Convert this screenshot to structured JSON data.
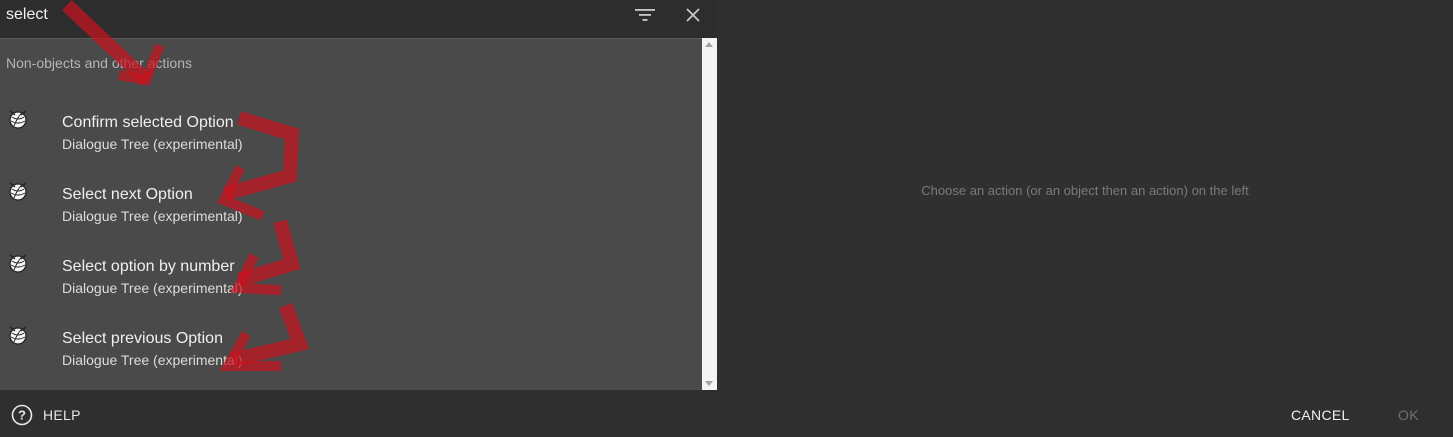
{
  "search": {
    "value": "select"
  },
  "list": {
    "section_label": "Non-objects and other actions",
    "items": [
      {
        "name": "Confirm selected Option",
        "group": "Dialogue Tree (experimental)"
      },
      {
        "name": "Select next Option",
        "group": "Dialogue Tree (experimental)"
      },
      {
        "name": "Select option by number",
        "group": "Dialogue Tree (experimental)"
      },
      {
        "name": "Select previous Option",
        "group": "Dialogue Tree (experimental)"
      }
    ]
  },
  "right_panel": {
    "message": "Choose an action (or an object then an action) on the left"
  },
  "footer": {
    "help_label": "HELP",
    "cancel_label": "CANCEL",
    "ok_label": "OK"
  },
  "icons": {
    "filter": "filter-icon",
    "close": "close-icon",
    "action": "yarn-ball-icon",
    "help": "help-circle-icon",
    "annotation": "red-arrow"
  },
  "colors": {
    "background": "#303030",
    "list_background": "#4a4a4a",
    "annotation_arrow": "#c8141e",
    "disabled_text": "#707070"
  }
}
